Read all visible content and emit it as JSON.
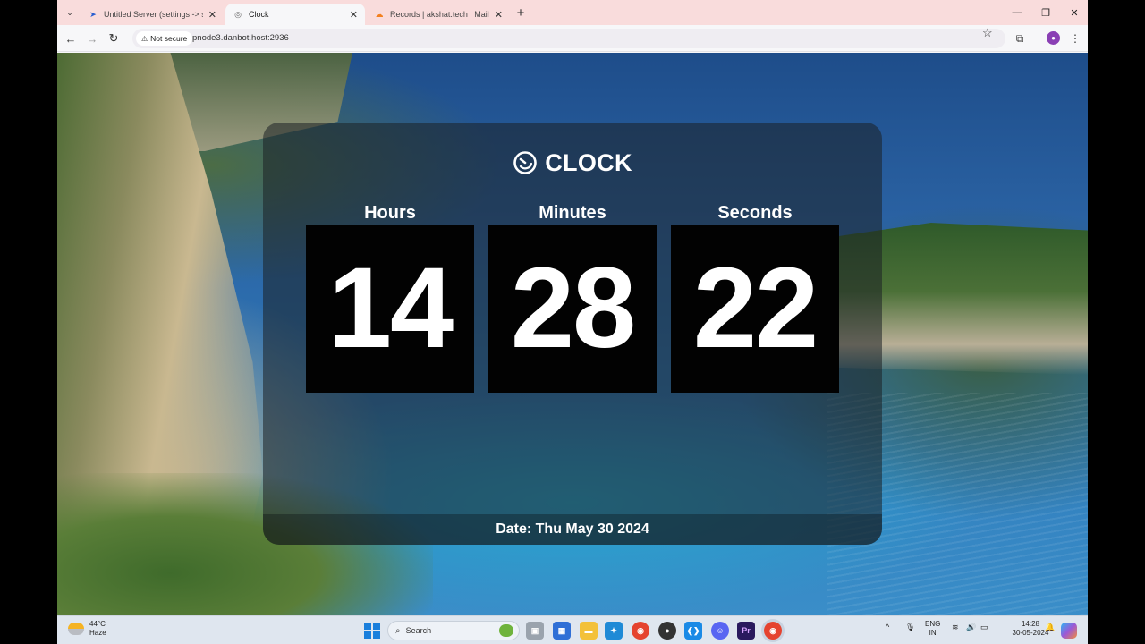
{
  "browser": {
    "tabs": [
      {
        "title": "Untitled Server (settings -> ser",
        "icon": "discord-bot-icon",
        "active": false
      },
      {
        "title": "Clock",
        "icon": "globe-icon",
        "active": true
      },
      {
        "title": "Records | akshat.tech | Mailleg",
        "icon": "cloudflare-icon",
        "active": false
      }
    ],
    "security_label": "Not secure",
    "url": "pnode3.danbot.host:2936"
  },
  "clock": {
    "title": "CLOCK",
    "hours_label": "Hours",
    "minutes_label": "Minutes",
    "seconds_label": "Seconds",
    "hours": "14",
    "minutes": "28",
    "seconds": "22",
    "date_text": "Date: Thu May 30 2024"
  },
  "taskbar": {
    "temperature": "44°C",
    "weather": "Haze",
    "search_placeholder": "Search",
    "lang_line1": "ENG",
    "lang_line2": "IN",
    "time": "14:28",
    "date": "30-05-2024"
  },
  "colors": {
    "tabstrip": "#f9dcdc",
    "card_bg": "rgba(28,32,36,0.55)",
    "digit_bg": "#020202",
    "profile": "#8a3fb4"
  }
}
